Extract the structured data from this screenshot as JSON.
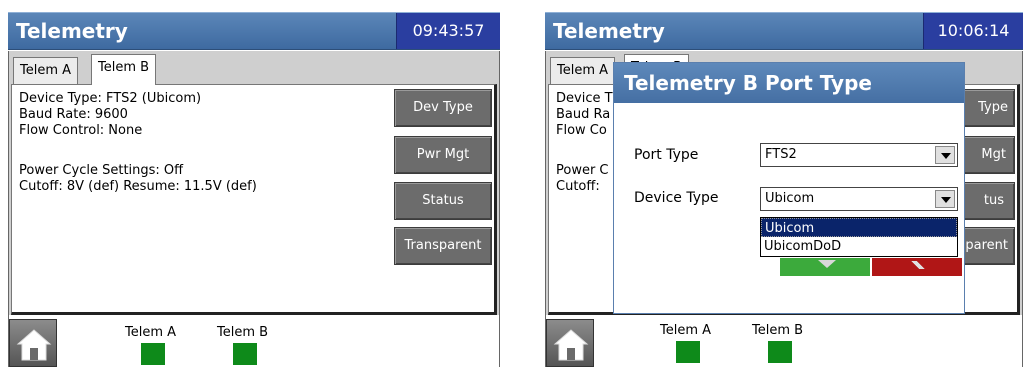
{
  "left": {
    "title": "Telemetry",
    "clock": "09:43:57",
    "tabs": [
      "Telem A",
      "Telem B"
    ],
    "info": {
      "device_type": "Device Type: FTS2 (Ubicom)",
      "baud_rate": "Baud Rate: 9600",
      "flow_control": "Flow Control: None",
      "power_cycle": "Power Cycle Settings: Off",
      "cutoff": "Cutoff: 8V (def) Resume: 11.5V (def)"
    },
    "buttons": [
      "Dev Type",
      "Pwr Mgt",
      "Status",
      "Transparent"
    ],
    "footer": {
      "led_a": "Telem A",
      "led_b": "Telem B"
    }
  },
  "right": {
    "title": "Telemetry",
    "clock": "10:06:14",
    "tabs": [
      "Telem A",
      "Telem B"
    ],
    "info_fragments": [
      "Device T",
      "Baud Ra",
      "Flow Co",
      "Power C",
      "Cutoff:"
    ],
    "button_fragments": [
      "Type",
      "Mgt",
      "tus",
      "parent"
    ],
    "dialog": {
      "title": "Telemetry B Port Type",
      "port_type_label": "Port Type",
      "port_type_value": "FTS2",
      "device_type_label": "Device Type",
      "device_type_value": "Ubicom",
      "options": [
        "Ubicom",
        "UbicomDoD"
      ]
    },
    "footer": {
      "led_a": "Telem A",
      "led_b": "Telem B"
    }
  },
  "colors": {
    "titlebar": "#4a77ad",
    "clock_bg": "#2a3ea0",
    "led_green": "#0e8a1a",
    "ok_green": "#3caa3c",
    "cancel_red": "#b01616",
    "selection": "#0a246a"
  },
  "icons": {
    "home": "home-icon"
  }
}
